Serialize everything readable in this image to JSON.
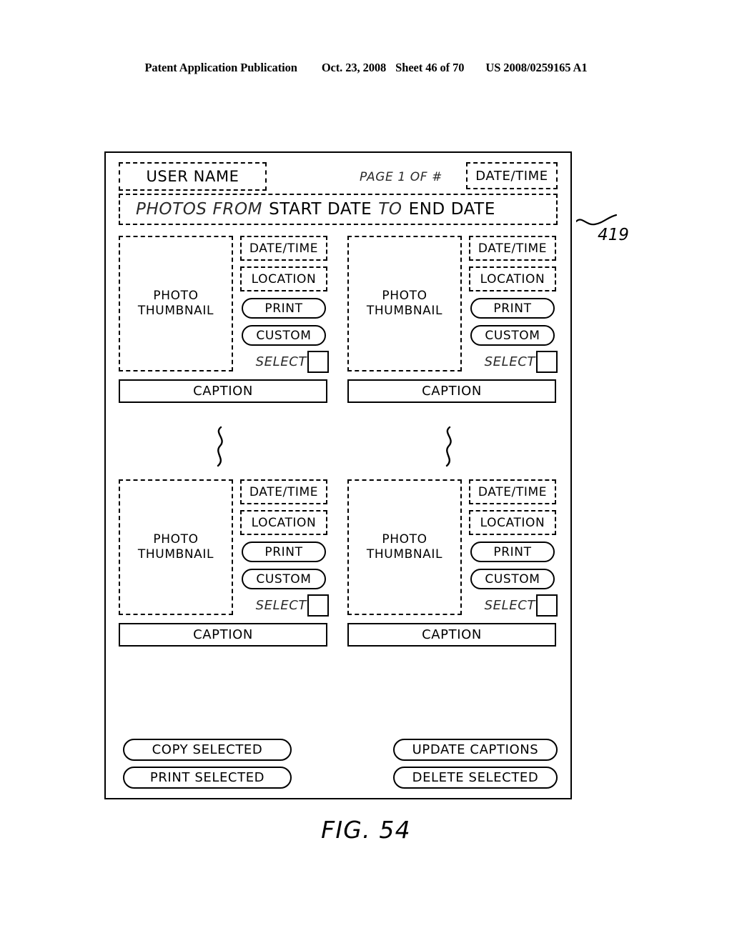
{
  "patent_header": {
    "publication": "Patent Application Publication",
    "date": "Oct. 23, 2008",
    "sheet": "Sheet 46 of 70",
    "number": "US 2008/0259165 A1"
  },
  "figure": {
    "caption": "FIG. 54",
    "reference_numeral": "419"
  },
  "screen": {
    "header": {
      "user_name": "USER NAME",
      "page_indicator": "PAGE 1 OF #",
      "date_time": "DATE/TIME",
      "range_prefix": "PHOTOS FROM",
      "range_start": "START DATE",
      "range_join": "TO",
      "range_end": "END DATE"
    },
    "photo_panels": [
      {
        "thumbnail_line1": "PHOTO",
        "thumbnail_line2": "THUMBNAIL",
        "date_time": "DATE/TIME",
        "location": "LOCATION",
        "print_label": "PRINT",
        "custom_label": "CUSTOM",
        "select_label": "SELECT",
        "select_checked": false,
        "caption_label": "CAPTION"
      },
      {
        "thumbnail_line1": "PHOTO",
        "thumbnail_line2": "THUMBNAIL",
        "date_time": "DATE/TIME",
        "location": "LOCATION",
        "print_label": "PRINT",
        "custom_label": "CUSTOM",
        "select_label": "SELECT",
        "select_checked": false,
        "caption_label": "CAPTION"
      },
      {
        "thumbnail_line1": "PHOTO",
        "thumbnail_line2": "THUMBNAIL",
        "date_time": "DATE/TIME",
        "location": "LOCATION",
        "print_label": "PRINT",
        "custom_label": "CUSTOM",
        "select_label": "SELECT",
        "select_checked": false,
        "caption_label": "CAPTION"
      },
      {
        "thumbnail_line1": "PHOTO",
        "thumbnail_line2": "THUMBNAIL",
        "date_time": "DATE/TIME",
        "location": "LOCATION",
        "print_label": "PRINT",
        "custom_label": "CUSTOM",
        "select_label": "SELECT",
        "select_checked": false,
        "caption_label": "CAPTION"
      }
    ],
    "actions": {
      "copy_selected": "COPY SELECTED",
      "print_selected": "PRINT SELECTED",
      "update_captions": "UPDATE CAPTIONS",
      "delete_selected": "DELETE SELECTED"
    }
  },
  "colors": {
    "ink": "#000000",
    "paper": "#ffffff",
    "italic_ink": "#2a2a2a"
  }
}
